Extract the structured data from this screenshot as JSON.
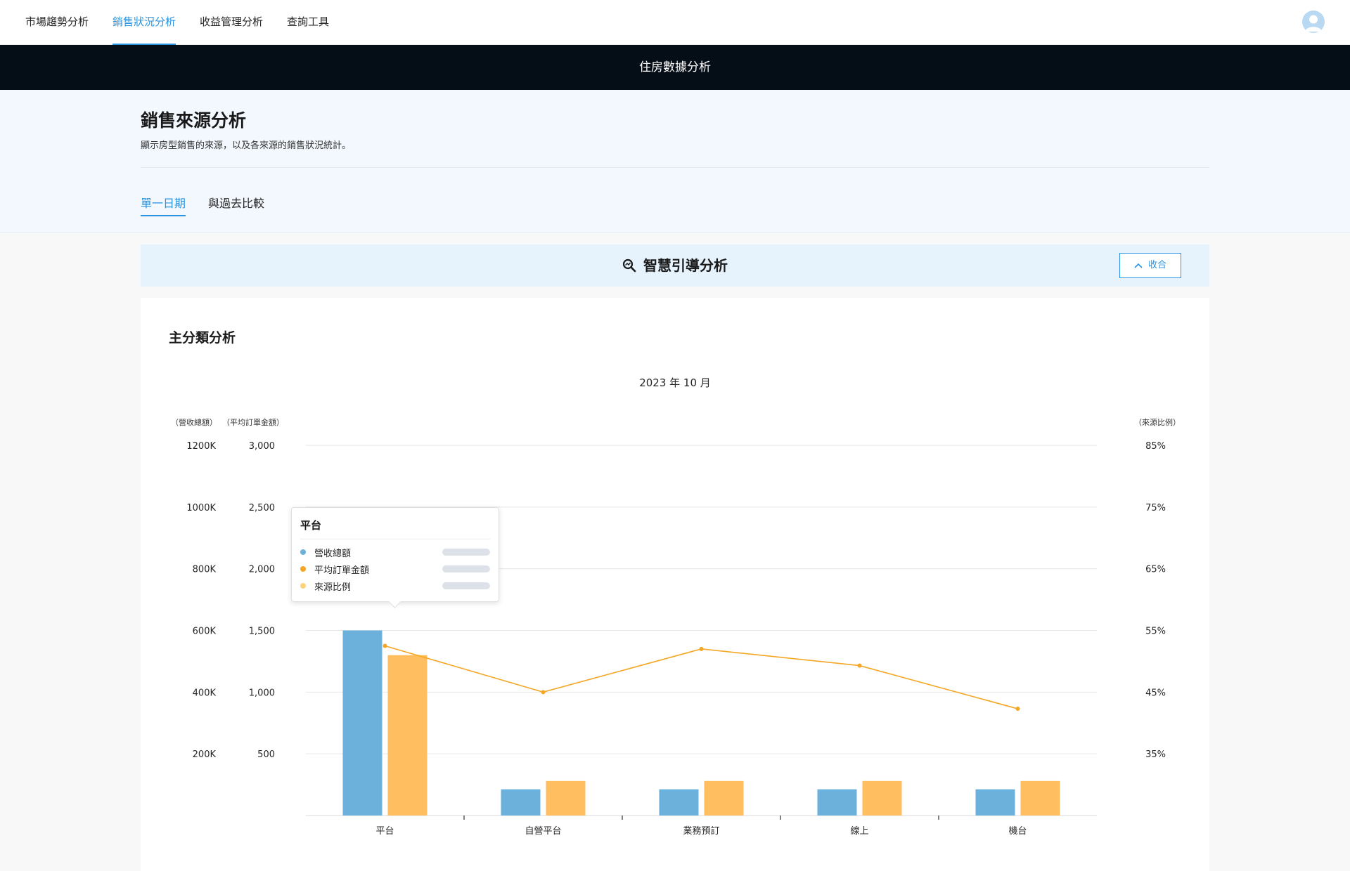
{
  "nav": {
    "tabs": [
      {
        "label": "市場趨勢分析",
        "active": false
      },
      {
        "label": "銷售狀況分析",
        "active": true
      },
      {
        "label": "收益管理分析",
        "active": false
      },
      {
        "label": "查詢工具",
        "active": false
      }
    ],
    "avatar_icon": "user-avatar-icon"
  },
  "header_bar": {
    "title": "住房數據分析"
  },
  "hero": {
    "title": "銷售來源分析",
    "description": "顯示房型銷售的來源，以及各來源的銷售狀況統計。",
    "tabs": [
      {
        "label": "單一日期",
        "active": true
      },
      {
        "label": "與過去比較",
        "active": false
      }
    ]
  },
  "banner": {
    "icon": "search-analytics-icon",
    "title": "智慧引導分析",
    "collapse_label": "收合",
    "collapse_icon": "chevron-up-icon"
  },
  "section": {
    "title": "主分類分析"
  },
  "tooltip": {
    "title": "平台",
    "items": [
      {
        "label": "營收總額",
        "color": "#6bb1dc"
      },
      {
        "label": "平均訂單金額",
        "color": "#f5a623"
      },
      {
        "label": "來源比例",
        "color": "#fcd27a"
      }
    ]
  },
  "colors": {
    "revenue": "#6bb1dc",
    "avg_order": "#ffbf60",
    "ratio_line": "#f5a623",
    "accent": "#2a94e0"
  },
  "chart_data": {
    "type": "bar",
    "title": "2023 年 10 月",
    "categories": [
      "平台",
      "自營平台",
      "業務預訂",
      "線上",
      "機台"
    ],
    "series": [
      {
        "name": "營收總額",
        "axis": "left1",
        "type": "bar",
        "values": [
          600,
          85,
          85,
          85,
          85
        ]
      },
      {
        "name": "平均訂單金額",
        "axis": "left2",
        "type": "bar",
        "values": [
          1300,
          280,
          280,
          280,
          280
        ]
      },
      {
        "name": "來源比例",
        "axis": "right",
        "type": "line",
        "values": [
          52.5,
          45,
          52,
          49.3,
          42.3
        ]
      }
    ],
    "axes": {
      "left1": {
        "label": "（營收總額）",
        "ylim": [
          0,
          1200
        ],
        "ticks": [
          200,
          400,
          600,
          800,
          1000,
          1200
        ],
        "tick_labels": [
          "200K",
          "400K",
          "600K",
          "800K",
          "1000K",
          "1200K"
        ]
      },
      "left2": {
        "label": "（平均訂單金額）",
        "ylim": [
          0,
          3000
        ],
        "ticks": [
          500,
          1000,
          1500,
          2000,
          2500,
          3000
        ],
        "tick_labels": [
          "500",
          "1,000",
          "1,500",
          "2,000",
          "2,500",
          "3,000"
        ]
      },
      "right": {
        "label": "（來源比例）",
        "ylim": [
          25,
          85
        ],
        "ticks": [
          35,
          45,
          55,
          65,
          75,
          85
        ],
        "tick_labels": [
          "35%",
          "45%",
          "55%",
          "65%",
          "75%",
          "85%"
        ]
      }
    },
    "grid": true,
    "legend": "none"
  }
}
